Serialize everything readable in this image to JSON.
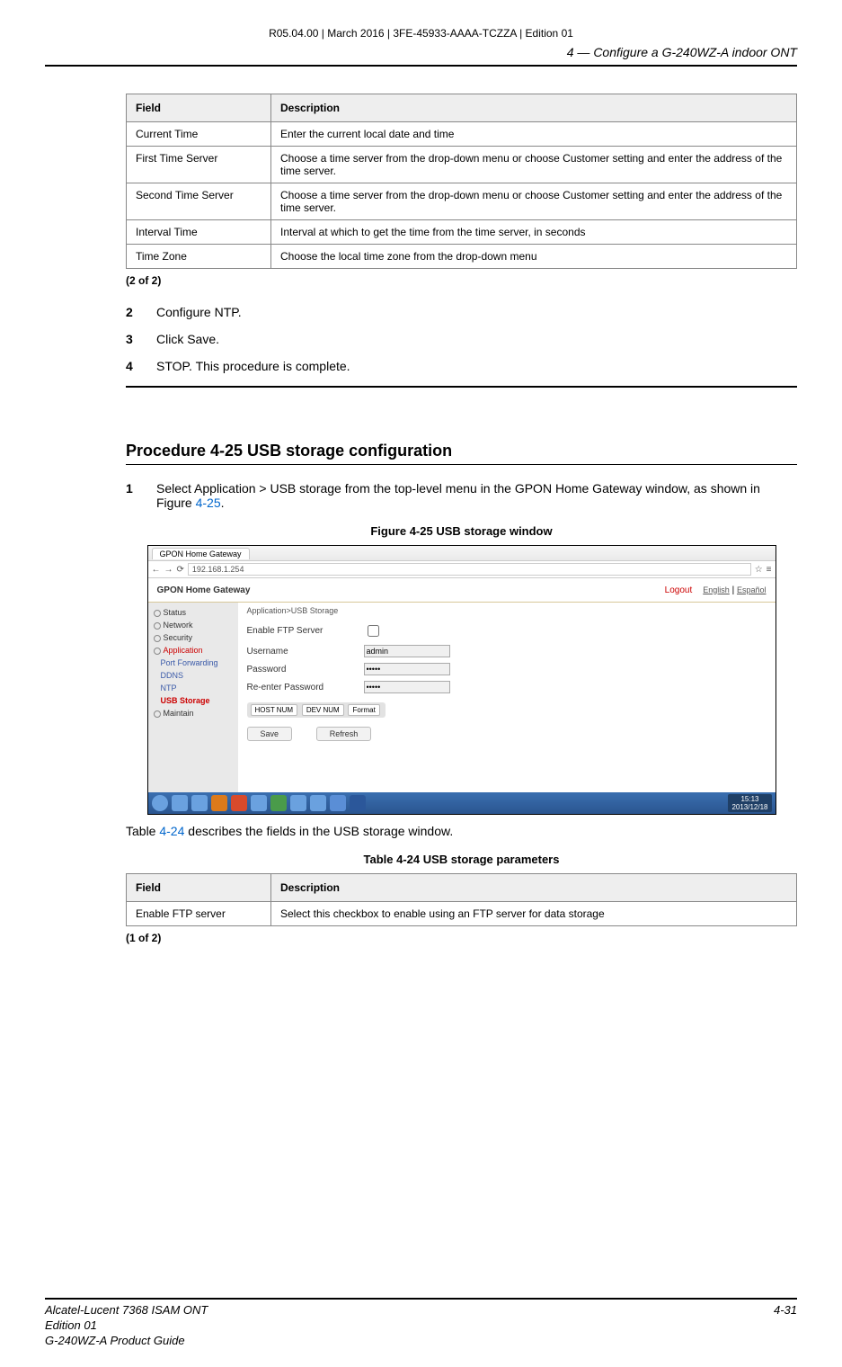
{
  "doc_id": "R05.04.00 | March 2016 | 3FE-45933-AAAA-TCZZA | Edition 01",
  "chapter_title": "4 —  Configure a G-240WZ-A indoor ONT",
  "table1": {
    "headers": {
      "field": "Field",
      "desc": "Description"
    },
    "rows": [
      {
        "field": "Current Time",
        "desc": "Enter the current local date and time"
      },
      {
        "field": "First Time Server",
        "desc": "Choose a time server from the drop-down menu or choose Customer setting and enter the address of the time server."
      },
      {
        "field": "Second Time Server",
        "desc": "Choose a time server from the drop-down menu or choose Customer setting and enter the address of the time server."
      },
      {
        "field": "Interval Time",
        "desc": "Interval at which to get the time from the time server, in seconds"
      },
      {
        "field": "Time Zone",
        "desc": "Choose the local time zone from the drop-down menu"
      }
    ],
    "footer": "(2 of 2)"
  },
  "steps_a": [
    {
      "num": "2",
      "txt": "Configure NTP."
    },
    {
      "num": "3",
      "txt": "Click Save."
    },
    {
      "num": "4",
      "txt": "STOP. This procedure is complete."
    }
  ],
  "procedure_heading": "Procedure 4-25  USB storage configuration",
  "step_b1_num": "1",
  "step_b1_pre": "Select Application > USB storage from the top-level menu in the GPON Home Gateway window, as shown in Figure ",
  "step_b1_link": "4-25",
  "step_b1_post": ".",
  "figure_caption": "Figure 4-25  USB storage window",
  "after_figure_pre": "Table ",
  "after_figure_link": "4-24",
  "after_figure_post": " describes the fields in the USB storage window.",
  "table2_caption": "Table 4-24 USB storage parameters",
  "table2": {
    "headers": {
      "field": "Field",
      "desc": "Description"
    },
    "rows": [
      {
        "field": "Enable FTP server",
        "desc": "Select this checkbox to enable using an FTP server for data storage"
      }
    ],
    "footer": "(1 of 2)"
  },
  "figure": {
    "tab_title": "GPON Home Gateway",
    "url": "192.168.1.254",
    "header_title": "GPON Home Gateway",
    "logout": "Logout",
    "lang_en": "English",
    "lang_es": "Español",
    "breadcrumb": "Application>USB Storage",
    "side": {
      "status": "Status",
      "network": "Network",
      "security": "Security",
      "application": "Application",
      "port_forwarding": "Port Forwarding",
      "ddns": "DDNS",
      "ntp": "NTP",
      "usb_storage": "USB Storage",
      "maintain": "Maintain"
    },
    "form": {
      "enable_label": "Enable FTP Server",
      "username_label": "Username",
      "username_value": "admin",
      "password_label": "Password",
      "password_value": "*****",
      "repassword_label": "Re-enter Password",
      "repassword_value": "*****"
    },
    "btns": {
      "host": "HOST NUM",
      "dev": "DEV NUM",
      "format": "Format",
      "save": "Save",
      "refresh": "Refresh"
    },
    "clock_time": "15:13",
    "clock_date": "2013/12/18"
  },
  "footer": {
    "left1": "Alcatel-Lucent 7368 ISAM ONT",
    "left2": "Edition 01",
    "left3": "G-240WZ-A Product Guide",
    "right": "4-31"
  }
}
